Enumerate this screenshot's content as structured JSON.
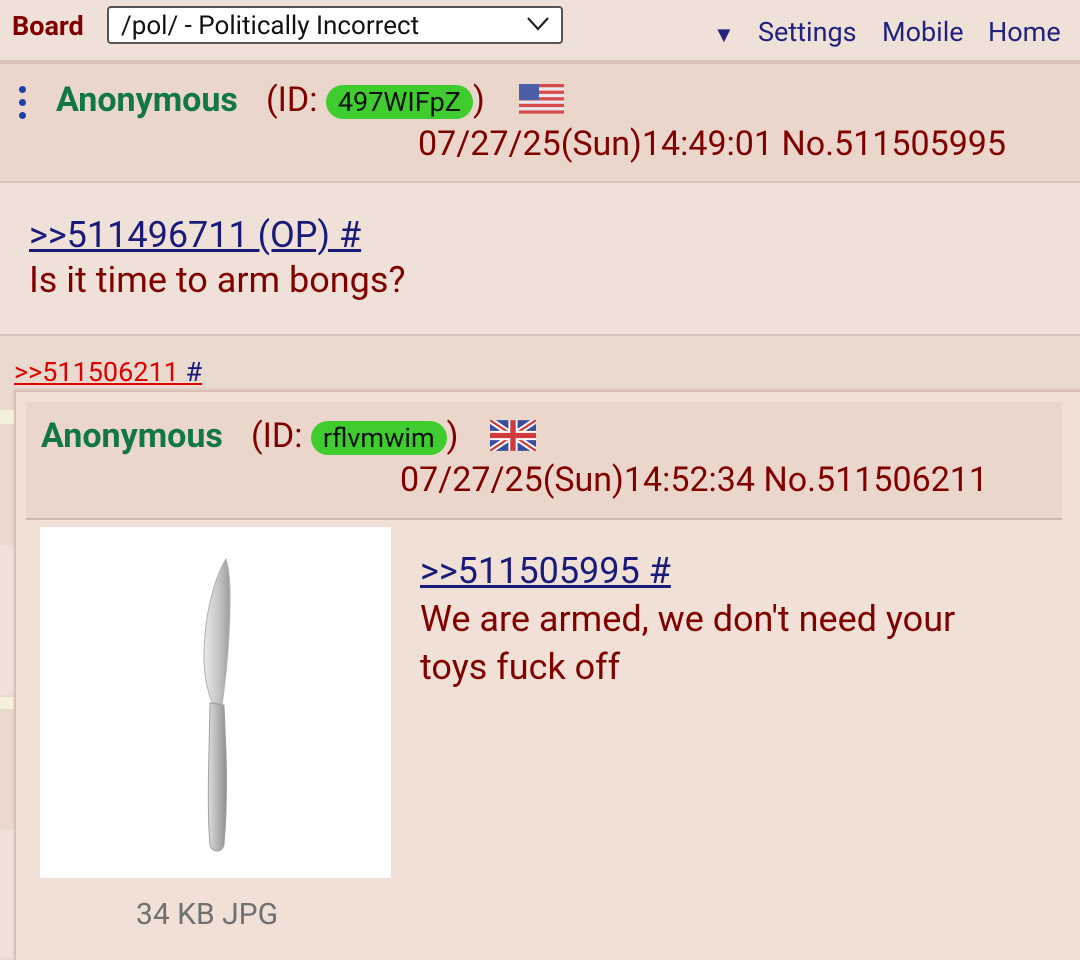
{
  "topbar": {
    "board_label": "Board",
    "board_select": "/pol/ - Politically Incorrect",
    "dropdown_arrow": "▼",
    "settings": "Settings",
    "mobile": "Mobile",
    "home": "Home"
  },
  "post1": {
    "name": "Anonymous",
    "id_prefix": "(ID:",
    "id": "497WIFpZ",
    "id_suffix": ")",
    "flag": "us-flag",
    "datetime": "07/27/25(Sun)14:49:01 No.511505995",
    "quote": ">>511496711 (OP) #",
    "text": "Is it time to arm bongs?"
  },
  "backlink": {
    "ref": ">>511506211",
    "hash": "#"
  },
  "preview": {
    "name": "Anonymous",
    "id_prefix": "(ID:",
    "id": "rflvmwim",
    "id_suffix": ")",
    "flag": "uk-flag",
    "datetime": "07/27/25(Sun)14:52:34 No.511506211",
    "quote": ">>511505995 #",
    "text_line1": "We are armed, we don't need your",
    "text_line2": "toys fuck off",
    "file_info": "34 KB JPG",
    "image": "knife-image"
  },
  "colors": {
    "background": "#efe1d8",
    "name": "#117743",
    "text": "#800000",
    "link": "#1a1a7a",
    "id_pill": "#3fcc2e",
    "ref_link": "#dd0000"
  }
}
